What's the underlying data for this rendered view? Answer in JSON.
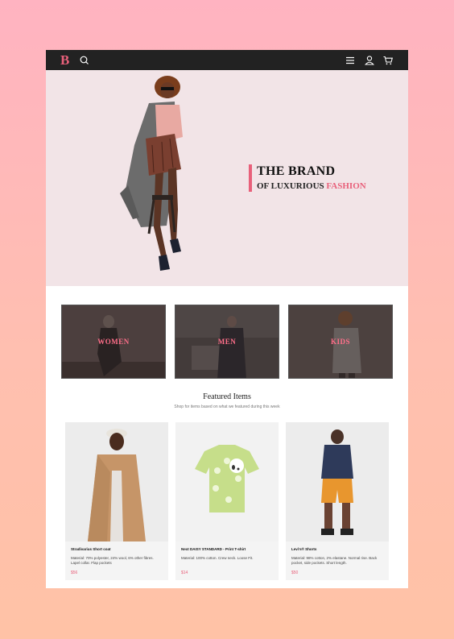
{
  "nav": {
    "logo": "B",
    "icons": [
      "search-icon",
      "menu-icon",
      "user-icon",
      "cart-icon"
    ]
  },
  "hero": {
    "title": "THE BRAND",
    "subtitle_prefix": "OF LUXURIOUS ",
    "subtitle_accent": "FASHION",
    "accent_color": "#e8607a"
  },
  "categories": [
    {
      "label": "WOMEN"
    },
    {
      "label": "MEN"
    },
    {
      "label": "KIDS"
    }
  ],
  "featured": {
    "title": "Featured Items",
    "subtitle": "Shop for items based on what we featured during this week"
  },
  "products": [
    {
      "name": "Stradivarius Short coat",
      "description": "Material: 70% polyester, 24% wool, 6% other fibres. Lapel collar. Flap pockets",
      "price": "$56"
    },
    {
      "name": "Next DAISY STANDARD - Print T-shirt",
      "description": "Material: 100% cotton. Crew neck. Loose Fit.",
      "price": "$14"
    },
    {
      "name": "Levi's® Shorts",
      "description": "Material: 98% cotton, 2% elastane. Normal rise. Back pocket, side pockets. Short length.",
      "price": "$50"
    }
  ]
}
